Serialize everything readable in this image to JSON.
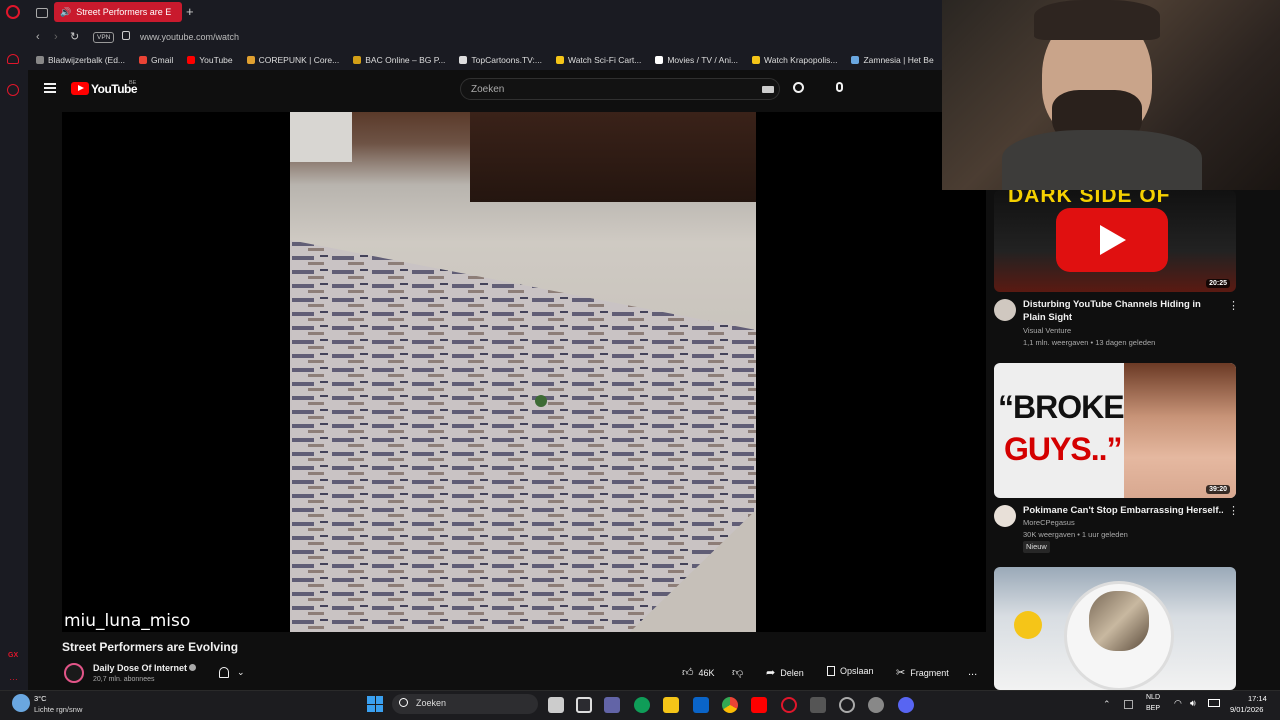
{
  "browser": {
    "tab_title": "Street Performers are E",
    "new_tab": "+",
    "vpn": "VPN",
    "url": "www.youtube.com/watch",
    "bookmarks": [
      {
        "label": "Bladwijzerbalk (Ed...",
        "color": "#888"
      },
      {
        "label": "Gmail",
        "color": "#ea4335"
      },
      {
        "label": "YouTube",
        "color": "#ff0000"
      },
      {
        "label": "COREPUNK | Core...",
        "color": "#e0a030"
      },
      {
        "label": "BAC Online – BG P...",
        "color": "#d4a017"
      },
      {
        "label": "TopCartoons.TV:...",
        "color": "#ddd"
      },
      {
        "label": "Watch Sci-Fi Cart...",
        "color": "#f5c518"
      },
      {
        "label": "Movies / TV / Ani...",
        "color": "#fff"
      },
      {
        "label": "Watch Krapopolis...",
        "color": "#f5c518"
      },
      {
        "label": "Zamnesia | Het Be",
        "color": "#6aa7e0"
      }
    ]
  },
  "youtube": {
    "logo": "YouTube",
    "region": "BE",
    "search_placeholder": "Zoeken"
  },
  "video": {
    "watermark": "miu_luna_miso",
    "title": "Street Performers are Evolving",
    "channel": "Daily Dose Of Internet",
    "subscribers": "20,7 mln. abonnees",
    "likes": "46K",
    "share": "Delen",
    "save": "Opslaan",
    "clip": "Fragment",
    "more": "..."
  },
  "recommendations": [
    {
      "title": "Disturbing YouTube Channels Hiding in Plain Sight",
      "channel": "Visual Venture",
      "meta": "1,1 mln. weergaven • 13 dagen geleden",
      "duration": "20:25",
      "thumb_text": "DARK SIDE OF"
    },
    {
      "title": "Pokimane Can't Stop Embarrassing Herself..",
      "channel": "MoreCPegasus",
      "meta": "30K weergaven • 1 uur geleden",
      "badge": "Nieuw",
      "duration": "39:20",
      "thumb_line1": "“BROKE",
      "thumb_line2": "GUYS..”"
    },
    {
      "title": "",
      "channel": "",
      "meta": "",
      "duration": ""
    }
  ],
  "taskbar": {
    "weather_temp": "3°C",
    "weather_desc": "Lichte rgn/snw",
    "search": "Zoeken",
    "lang1": "NLD",
    "lang2": "BEP",
    "time": "17:14",
    "date": "9/01/2026"
  },
  "colors": {
    "opera_red": "#e0162b",
    "yt_red": "#ff0000",
    "bg": "#0f0f0f"
  }
}
